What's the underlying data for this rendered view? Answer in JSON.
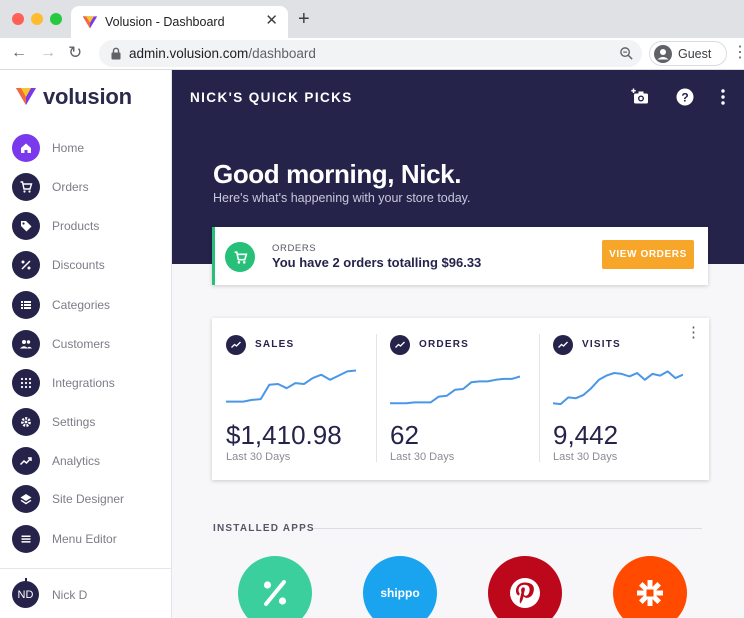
{
  "browser": {
    "tab_title": "Volusion - Dashboard",
    "url_host": "admin.volusion.com",
    "url_path": "/dashboard",
    "profile_label": "Guest"
  },
  "sidebar": {
    "brand": "volusion",
    "items": [
      {
        "label": "Home",
        "icon": "home-icon",
        "active": true
      },
      {
        "label": "Orders",
        "icon": "cart-icon"
      },
      {
        "label": "Products",
        "icon": "tag-icon"
      },
      {
        "label": "Discounts",
        "icon": "percent-icon"
      },
      {
        "label": "Categories",
        "icon": "list-icon"
      },
      {
        "label": "Customers",
        "icon": "people-icon"
      },
      {
        "label": "Integrations",
        "icon": "apps-grid-icon"
      },
      {
        "label": "Settings",
        "icon": "gear-icon"
      },
      {
        "label": "Analytics",
        "icon": "trending-icon"
      },
      {
        "label": "Site Designer",
        "icon": "layers-icon"
      },
      {
        "label": "Menu Editor",
        "icon": "menu-icon"
      }
    ],
    "user": {
      "initials": "ND",
      "name": "Nick D"
    }
  },
  "header": {
    "title": "NICK'S QUICK PICKS"
  },
  "hero": {
    "greeting": "Good morning, Nick.",
    "subtitle": "Here's what's happening with your store today."
  },
  "orders_card": {
    "label": "ORDERS",
    "text": "You have 2 orders totalling $96.33",
    "button": "VIEW ORDERS"
  },
  "stats": [
    {
      "label": "SALES",
      "value": "$1,410.98",
      "period": "Last 30 Days",
      "trend": [
        10,
        10,
        10,
        12,
        13,
        30,
        31,
        26,
        32,
        31,
        38,
        42,
        36,
        41,
        46,
        47
      ]
    },
    {
      "label": "ORDERS",
      "value": "62",
      "period": "Last 30 Days",
      "trend": [
        8,
        8,
        8,
        9,
        9,
        9,
        16,
        17,
        24,
        25,
        33,
        34,
        34,
        36,
        37,
        37,
        40
      ]
    },
    {
      "label": "VISITS",
      "value": "9,442",
      "period": "Last 30 Days",
      "trend": [
        8,
        7,
        15,
        14,
        18,
        26,
        36,
        41,
        44,
        43,
        40,
        44,
        36,
        43,
        41,
        46,
        38,
        42
      ]
    }
  ],
  "installed_apps": {
    "title": "INSTALLED APPS",
    "apps": [
      {
        "name": "percent-app",
        "color": "#3bcf9d"
      },
      {
        "name": "shippo",
        "label": "shippo",
        "color": "#1aa3ee"
      },
      {
        "name": "pinterest",
        "color": "#bd081c"
      },
      {
        "name": "zapier",
        "color": "#ff4a00"
      }
    ]
  },
  "colors": {
    "navy": "#25234a",
    "accent_purple": "#7b39ed",
    "success_green": "#27c079",
    "button_orange": "#f7a62a",
    "chart_blue": "#4a97e8"
  }
}
